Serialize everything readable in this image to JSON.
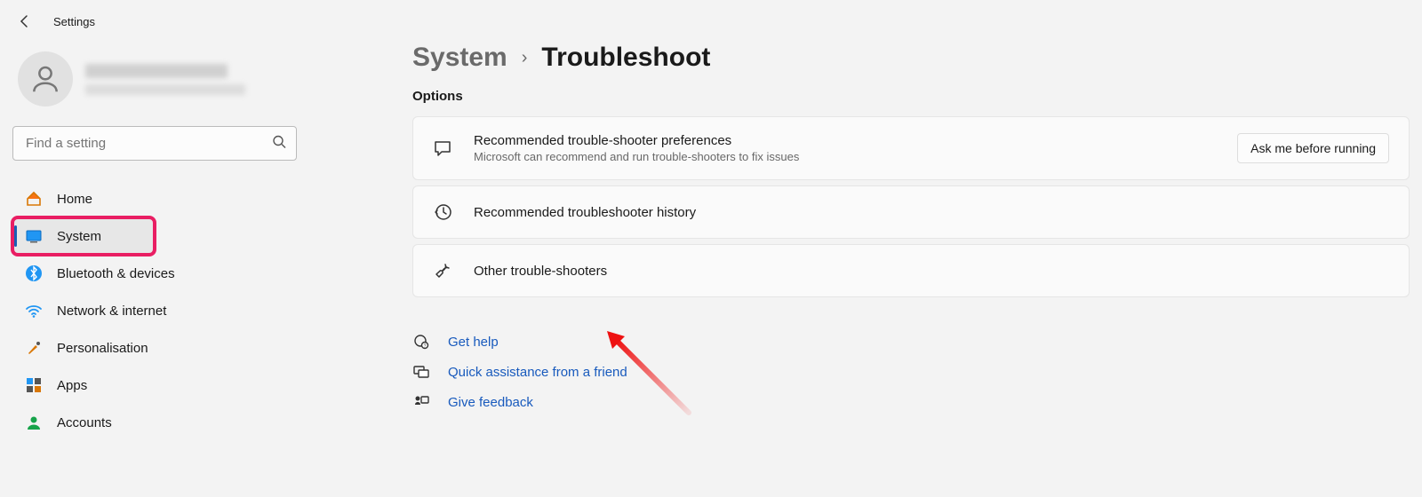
{
  "header": {
    "title": "Settings"
  },
  "search": {
    "placeholder": "Find a setting"
  },
  "nav": {
    "items": [
      {
        "label": "Home"
      },
      {
        "label": "System"
      },
      {
        "label": "Bluetooth & devices"
      },
      {
        "label": "Network & internet"
      },
      {
        "label": "Personalisation"
      },
      {
        "label": "Apps"
      },
      {
        "label": "Accounts"
      }
    ],
    "selected_index": 1
  },
  "breadcrumb": {
    "parent": "System",
    "current": "Troubleshoot"
  },
  "sections": {
    "options_label": "Options",
    "cards": [
      {
        "title": "Recommended trouble-shooter preferences",
        "subtitle": "Microsoft can recommend and run trouble-shooters to fix issues",
        "action": "Ask me before running"
      },
      {
        "title": "Recommended troubleshooter history"
      },
      {
        "title": "Other trouble-shooters"
      }
    ]
  },
  "links": [
    {
      "label": "Get help"
    },
    {
      "label": "Quick assistance from a friend"
    },
    {
      "label": "Give feedback"
    }
  ],
  "colors": {
    "accent": "#185abd",
    "highlight": "#e91e63"
  }
}
